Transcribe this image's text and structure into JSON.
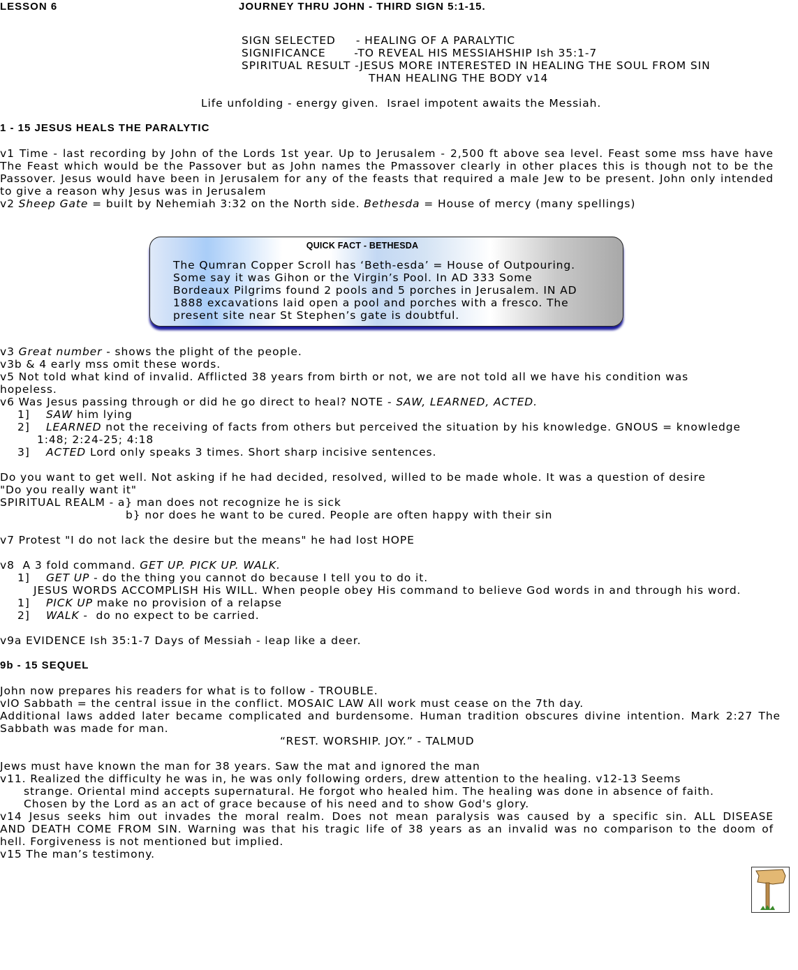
{
  "header": {
    "lesson": "LESSON 6",
    "title": "JOURNEY THRU JOHN - THIRD SIGN 5:1-15."
  },
  "summary": {
    "line1": "SIGN SELECTED     - HEALING OF A PARALYTIC",
    "line2": "SIGNIFICANCE       -TO REVEAL HIS MESSIAHSHIP Ish 35:1-7",
    "line3": "SPIRITUAL RESULT -JESUS MORE INTERESTED IN HEALING THE SOUL FROM SIN",
    "line4": "THAN HEALING THE BODY v14"
  },
  "tagline": "Life unfolding - energy given.  Israel impotent awaits the Messiah.",
  "section1": {
    "heading": "1 - 15 JESUS HEALS THE PARALYTIC",
    "v1": [
      "v1 Time - last recording by John of the Lords 1st year. Up to Jerusalem - 2,500 ft above sea level. Feast some mss have have",
      "The Feast which would be the Passover but as John names the Pmassover clearly in other places this is though not to be the",
      "Passover. Jesus would have been in Jerusalem for any of the feasts that required a male Jew to be present. John only intended",
      "to give a reason why Jesus was in Jerusalem"
    ],
    "v2": {
      "a": "v2 ",
      "b": "Sheep Gate",
      "c": " = built by Nehemiah 3:32 on the North side. ",
      "d": "Bethesda",
      "e": " = House of mercy (many spellings)"
    }
  },
  "quick_fact": {
    "title": "QUICK FACT - BETHESDA",
    "lines": [
      "The Qumran Copper Scroll has ‘Beth-esda’ = House of Outpouring.",
      "Some say it was Gihon or the Virgin’s Pool. In AD 333 Some",
      "Bordeaux Pilgrims found 2 pools and 5 porches in Jerusalem. IN AD",
      "1888 excavations laid open a pool and porches with a fresco. The",
      "present site near St Stephen’s gate is doubtful."
    ]
  },
  "notes": {
    "v3a": "v3 ",
    "v3b": "Great number",
    "v3c": " - shows the plight of the people.",
    "v3b4": "v3b & 4 early mss omit these words.",
    "v5a": "v5 Not told what kind of invalid. Afflicted 38 years from birth or not, we are not told all we have his condition was",
    "v5b": "hopeless.",
    "v6a": "v6 Was Jesus passing through or did he go direct to heal? NOTE - ",
    "v6b": "SAW, LEARNED, ACTED.",
    "s1n": "1]",
    "s1a": "SAW",
    "s1b": " him lying",
    "s2n": "2]",
    "s2a": "LEARNED",
    "s2b": " not the receiving of facts from others but perceived the situation by his knowledge. GNOUS = knowledge",
    "s2c": "1:48; 2:24-25; 4:18",
    "s3n": "3]",
    "s3a": "ACTED",
    "s3b": " Lord only speaks 3 times. Short sharp incisive sentences.",
    "want1": "Do you want to get well. Not asking if he had decided, resolved, willed to be made whole. It was a question of desire",
    "want2": "\"Do you really want it\"",
    "realm1": "SPIRITUAL REALM - a} man does not recognize he is sick",
    "realm2": "b} nor does he want to be cured. People are often happy with their sin",
    "v7": "v7 Protest \"I do not lack the desire but the means\" he had lost HOPE",
    "v8a": "v8  A 3 fold command. ",
    "v8b": "GET UP. PICK UP. WALK.",
    "c1n": "1]",
    "c1a": "GET UP",
    "c1b": " - do the thing you cannot do because I tell you to do it.",
    "c1c": "JESUS WORDS ACCOMPLISH His WILL. When people obey His command to believe God words in and through his word.",
    "c2n": "1]",
    "c2a": "PICK UP",
    "c2b": " make no provision of a relapse",
    "c3n": "2]",
    "c3a": "WALK",
    "c3b": " -  do no expect to be carried.",
    "v9a": "v9a EVIDENCE Ish 35:1-7 Days of Messiah - leap like a deer."
  },
  "section2": {
    "heading": "9b - 15 SEQUEL",
    "l1": "John now prepares his readers for what is to follow - TROUBLE.",
    "l2": "vlO Sabbath = the central issue in the conflict. MOSAIC LAW All work must cease on the 7th day.",
    "l3": "Additional laws added later became complicated and burdensome. Human tradition obscures divine intention. Mark 2:27 The",
    "l4": "Sabbath was made for man.",
    "quote": "“REST. WORSHIP. JOY.” - TALMUD",
    "l5": "Jews must have known the man for 38 years. Saw the mat and ignored the man",
    "l6": "v11. Realized the difficulty he was in, he was only following orders, drew attention to the healing. v12-13 Seems",
    "l7": "strange. Oriental mind accepts supernatural. He forgot who healed him. The healing was done in absence of faith.",
    "l8": "Chosen by the Lord as an act of grace because of his need and to show God's glory.",
    "l9": "v14 Jesus seeks him out invades the moral realm. Does not mean paralysis was caused by a specific sin. ALL DISEASE",
    "l10": "AND DEATH COME FROM SIN. Warning was that his tragic life of 38 years as an invalid was no comparison to the doom of",
    "l11": "hell. Forgiveness is not mentioned but implied.",
    "l12": "v15 The man’s testimony."
  },
  "icons": {
    "corner": "signpost-icon"
  }
}
